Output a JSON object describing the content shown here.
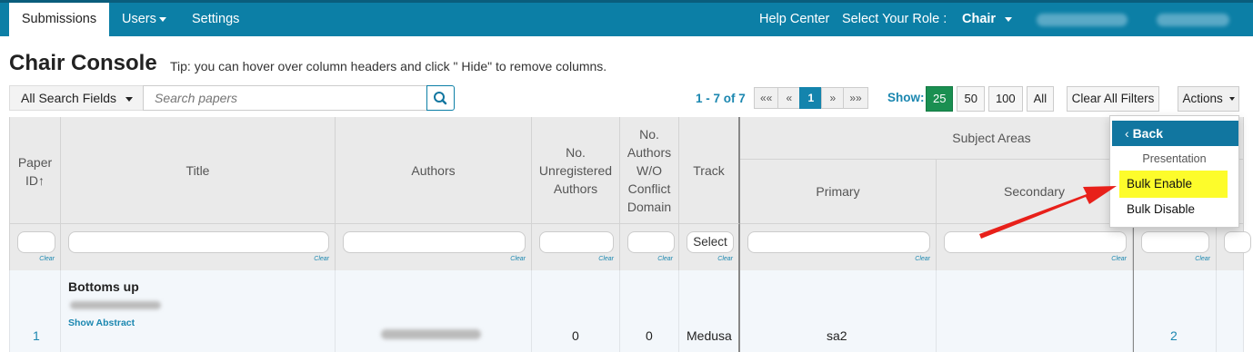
{
  "nav": {
    "submissions": "Submissions",
    "users": "Users",
    "settings": "Settings",
    "help_center": "Help Center",
    "select_role_label": "Select Your Role :",
    "role": "Chair"
  },
  "header": {
    "title": "Chair Console",
    "tip": "Tip: you can hover over column headers and click \" Hide\" to remove columns."
  },
  "toolbar": {
    "search_fields": "All Search Fields",
    "search_placeholder": "Search papers",
    "range": "1 - 7 of 7",
    "pager": [
      "««",
      "«",
      "1",
      "»",
      "»»"
    ],
    "show_label": "Show:",
    "page_sizes": [
      "25",
      "50",
      "100",
      "All"
    ],
    "clear_all": "Clear All Filters",
    "actions": "Actions"
  },
  "table": {
    "headers": {
      "paper_id": "Paper ID",
      "sort_icon": "↑",
      "title": "Title",
      "authors": "Authors",
      "unregistered": "No. Unregistered Authors",
      "wo_conflict": "No. Authors W/O Conflict Domain",
      "track": "Track",
      "subject_areas": "Subject Areas",
      "primary": "Primary",
      "secondary": "Secondary"
    },
    "filter": {
      "clear": "Clear",
      "track_select": "Select"
    },
    "rows": [
      {
        "paper_id": "1",
        "title": "Bottoms up",
        "show_abstract": "Show Abstract",
        "unregistered": "0",
        "wo_conflict": "0",
        "track": "Medusa",
        "primary": "sa2",
        "count": "2"
      }
    ]
  },
  "actions_menu": {
    "back": "Back",
    "section": "Presentation",
    "items": [
      "Bulk Enable",
      "Bulk Disable"
    ]
  },
  "colors": {
    "nav": "#0c7fa6",
    "highlight": "#fdfc2b",
    "arrow": "#e8201a",
    "page_current": "#1a8f51"
  }
}
